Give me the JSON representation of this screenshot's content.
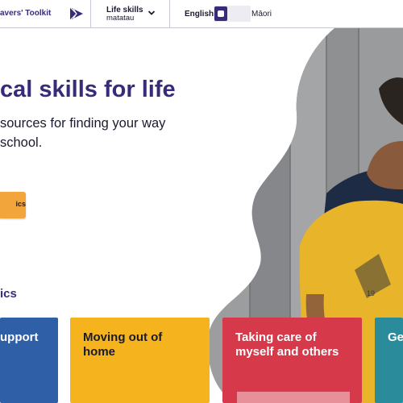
{
  "header": {
    "brand": "avers' Toolkit",
    "life_skills_title": "Life skills",
    "life_skills_sub": "matatau",
    "lang_english": "English",
    "lang_maori": "Māori"
  },
  "hero": {
    "title": "cal skills for life",
    "subtitle": "sources for finding your way school.",
    "button_label": "ics"
  },
  "topics": {
    "heading": "ics",
    "cards": [
      {
        "label": "upport",
        "color": "#2f5fa7"
      },
      {
        "label": "Moving out of home",
        "color": "#f5b41e"
      },
      {
        "label": "Taking care of myself and others",
        "color": "#d63a4a"
      },
      {
        "label": "Ge",
        "color": "#2a8c9a"
      }
    ]
  },
  "colors": {
    "brand_purple": "#3a2a7a",
    "button_orange": "#f2a53a",
    "shirt_yellow": "#e8b42a",
    "hoodie_navy": "#1e2b45"
  }
}
